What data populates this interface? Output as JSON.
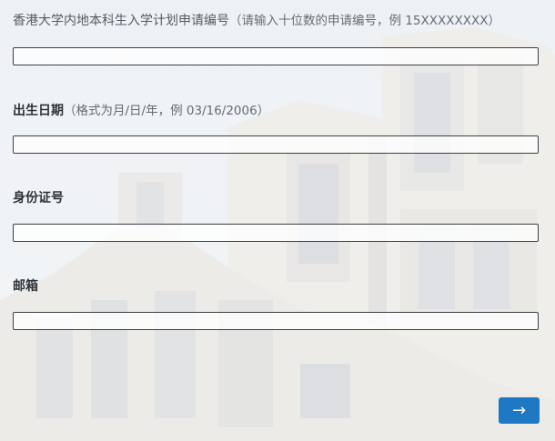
{
  "form": {
    "fields": [
      {
        "label": "香港大学内地本科生入学计划申请编号",
        "hint": "（请输入十位数的申请编号，例 15XXXXXXXX）",
        "value": ""
      },
      {
        "label": "出生日期",
        "hint": "（格式为月/日/年，例 03/16/2006）",
        "value": ""
      },
      {
        "label": "身份证号",
        "hint": "",
        "value": ""
      },
      {
        "label": "邮箱",
        "hint": "",
        "value": ""
      }
    ],
    "next_icon": "→"
  },
  "colors": {
    "accent": "#1f78c4",
    "field_border": "#3a3f45",
    "label_text": "#2e3338"
  },
  "icons": {
    "next": "arrow-right-icon"
  }
}
